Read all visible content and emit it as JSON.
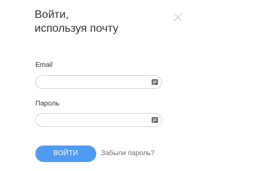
{
  "dialog": {
    "title_line1": "Войти,",
    "title_line2": "используя почту",
    "close_icon": "close-icon"
  },
  "form": {
    "email": {
      "label": "Email",
      "value": "",
      "placeholder": "",
      "icon": "password-manager-key-icon"
    },
    "password": {
      "label": "Пароль",
      "value": "",
      "placeholder": "",
      "icon": "password-manager-key-icon"
    },
    "submit_label": "ВОЙТИ",
    "forgot_label": "Забыли пароль?"
  },
  "colors": {
    "accent": "#4f9bf3",
    "text": "#333333",
    "muted": "#6b6b6b",
    "border": "#d4d4d4",
    "close": "#cccccc"
  }
}
